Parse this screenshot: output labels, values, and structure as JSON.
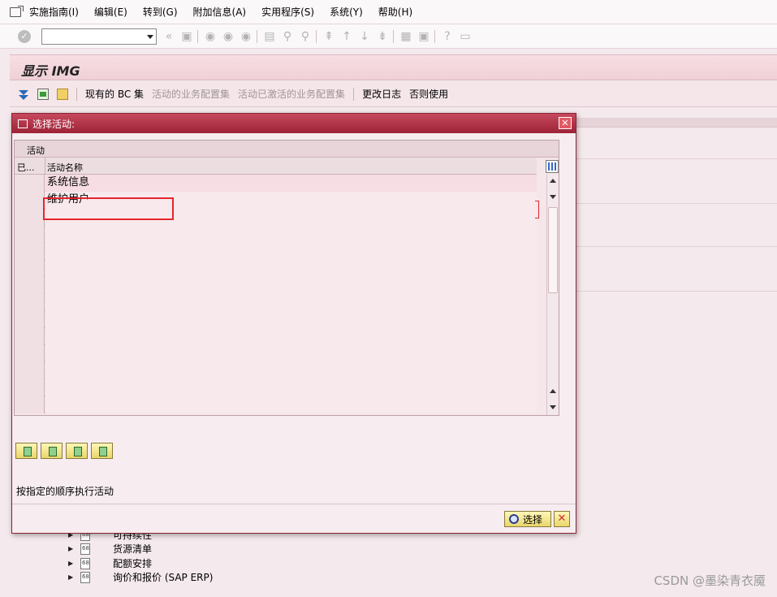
{
  "menu": {
    "items": [
      "实施指南(I)",
      "编辑(E)",
      "转到(G)",
      "附加信息(A)",
      "实用程序(S)",
      "系统(Y)",
      "帮助(H)"
    ]
  },
  "toolbar": {
    "command_value": ""
  },
  "screen": {
    "title": "显示 IMG"
  },
  "app_toolbar": {
    "bc_sets": "现有的 BC 集",
    "activity_bc_sets": "活动的业务配置集",
    "activated_bc_sets": "活动已激活的业务配置集",
    "change_log": "更改日志",
    "else_use": "否则使用"
  },
  "dialog": {
    "title": "选择活动:",
    "grid_caption": "活动",
    "col_done": "已...",
    "col_name": "活动名称",
    "rows": [
      {
        "done": "",
        "name": "系统信息"
      },
      {
        "done": "",
        "name": "维护用户"
      },
      {
        "done": "",
        "name": ""
      },
      {
        "done": "",
        "name": ""
      },
      {
        "done": "",
        "name": ""
      },
      {
        "done": "",
        "name": ""
      },
      {
        "done": "",
        "name": ""
      },
      {
        "done": "",
        "name": ""
      },
      {
        "done": "",
        "name": ""
      },
      {
        "done": "",
        "name": ""
      },
      {
        "done": "",
        "name": ""
      },
      {
        "done": "",
        "name": ""
      },
      {
        "done": "",
        "name": ""
      },
      {
        "done": "",
        "name": ""
      }
    ],
    "hint": "按指定的顺序执行活动",
    "ok_label": "选择"
  },
  "tree": {
    "items": [
      "可持续性",
      "货源清单",
      "配额安排",
      "询价和报价 (SAP ERP)"
    ]
  },
  "watermark": "CSDN @墨染青衣魇",
  "colors": {
    "dialog_title": "#b03248",
    "highlight": "#e5262e",
    "button": "#f2e089"
  }
}
